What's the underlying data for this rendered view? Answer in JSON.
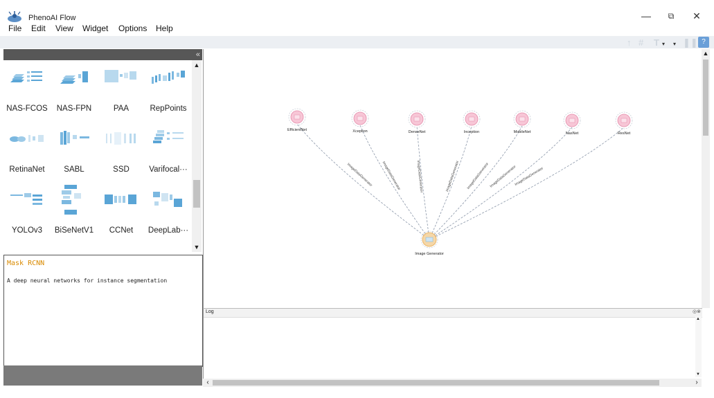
{
  "app": {
    "title": "PhenoAI Flow"
  },
  "window_controls": {
    "minimize": "—",
    "maximize": "⧉",
    "close": "✕"
  },
  "menu": [
    "File",
    "Edit",
    "View",
    "Widget",
    "Options",
    "Help"
  ],
  "toolbar_icons": [
    "arrow-icon",
    "grid-icon",
    "text-icon",
    "dropdown-icon",
    "pause-icon",
    "help-icon"
  ],
  "left_panel": {
    "collapse": "«",
    "widgets": [
      "NAS-FCOS",
      "NAS-FPN",
      "PAA",
      "RepPoints",
      "RetinaNet",
      "SABL",
      "SSD",
      "Varifocal···",
      "YOLOv3",
      "BiSeNetV1",
      "CCNet",
      "DeepLab···"
    ]
  },
  "description": {
    "title": "Mask RCNN",
    "text": "A deep neural networks for instance segmentation"
  },
  "canvas": {
    "source_node": "Image Generator",
    "nodes": [
      "EfficientNet",
      "Xception",
      "DenseNet",
      "Inception",
      "MobileNet",
      "NasNet",
      "ResNet"
    ],
    "edge_labels": [
      "ImageDataGenerator",
      "ImageDataGenerator",
      "ImageDataGenerator",
      "ImageDataGenerator",
      "ImageDataGenerator",
      "ImageDataGenerator",
      "ImageDataGenerator"
    ]
  },
  "log": {
    "title": "Log",
    "controls": "◎⊗"
  },
  "colors": {
    "node_fill": "#f7c6d6",
    "source_fill": "#f5d7a8",
    "accent": "#d98a00",
    "thumb_blue": "#5aa5d6"
  }
}
